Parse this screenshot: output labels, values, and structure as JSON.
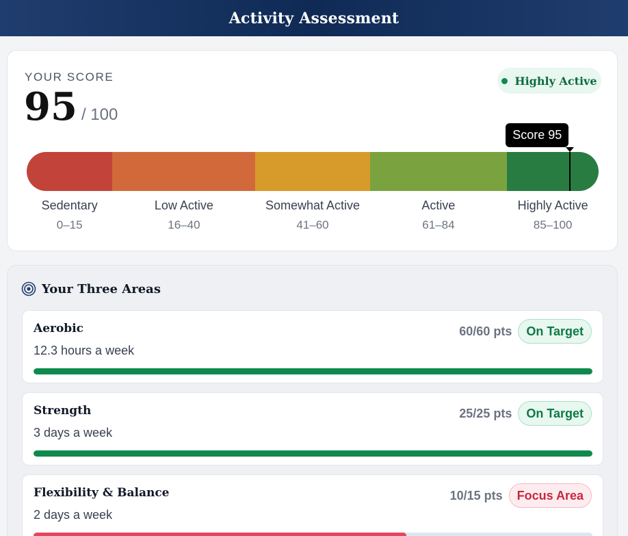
{
  "header": {
    "title": "Activity Assessment"
  },
  "score": {
    "caption": "YOUR SCORE",
    "value": "95",
    "max": "/ 100",
    "level_badge": "Highly Active",
    "tooltip": "Score 95"
  },
  "scale": {
    "min": 0,
    "max": 100,
    "marker_value": 95,
    "categories": [
      {
        "label": "Sedentary",
        "range": "0–15",
        "from": 0,
        "to": 15,
        "color": "#c2433a"
      },
      {
        "label": "Low Active",
        "range": "16–40",
        "from": 15,
        "to": 40,
        "color": "#d2693b"
      },
      {
        "label": "Somewhat Active",
        "range": "41–60",
        "from": 40,
        "to": 60,
        "color": "#d79b2b"
      },
      {
        "label": "Active",
        "range": "61–84",
        "from": 60,
        "to": 84,
        "color": "#7aa33f"
      },
      {
        "label": "Highly Active",
        "range": "85–100",
        "from": 84,
        "to": 100,
        "color": "#287c42"
      }
    ]
  },
  "areas": {
    "title": "Your Three Areas",
    "items": [
      {
        "name": "Aerobic",
        "detail": "12.3 hours a week",
        "points": "60/60 pts",
        "status": "On Target",
        "status_type": "on",
        "progress": 1.0,
        "bar_color": "#0e8a4c",
        "track_color": "#dcefe5"
      },
      {
        "name": "Strength",
        "detail": "3 days a week",
        "points": "25/25 pts",
        "status": "On Target",
        "status_type": "on",
        "progress": 1.0,
        "bar_color": "#0e8a4c",
        "track_color": "#dcefe5"
      },
      {
        "name": "Flexibility & Balance",
        "detail": "2 days a week",
        "points": "10/15 pts",
        "status": "Focus Area",
        "status_type": "focus",
        "progress": 0.667,
        "bar_color": "#e3475f",
        "track_color": "#dbe7f2"
      }
    ]
  }
}
